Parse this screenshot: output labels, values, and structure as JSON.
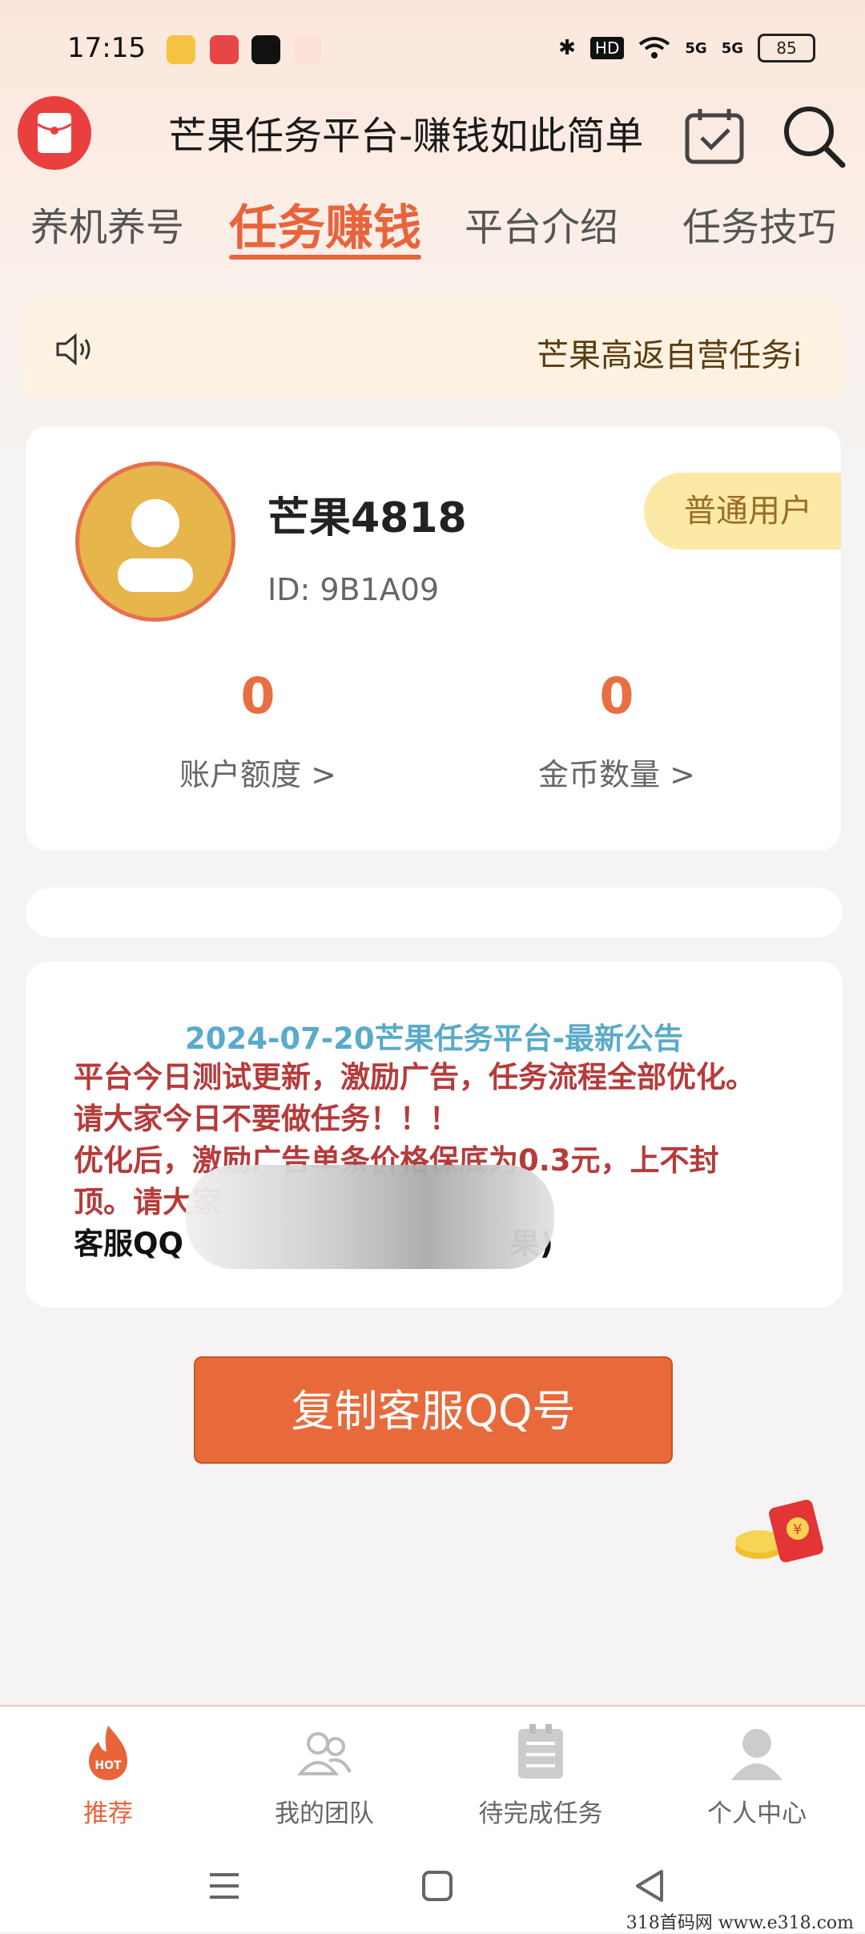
{
  "status_bar": {
    "time": "17:15",
    "battery": "85",
    "network_label": "5G",
    "hd_label": "HD"
  },
  "header": {
    "title": "芒果任务平台-赚钱如此简单",
    "icons": [
      "red-packet-icon",
      "calendar-check-icon",
      "search-icon"
    ]
  },
  "tabs": [
    {
      "label": "养机养号",
      "active": false
    },
    {
      "label": "任务赚钱",
      "active": true
    },
    {
      "label": "平台介绍",
      "active": false
    },
    {
      "label": "任务技巧",
      "active": false
    }
  ],
  "notice": {
    "text": "芒果高返自营任务i"
  },
  "profile": {
    "username": "芒果4818",
    "id": "ID: 9B1A09",
    "level": "普通用户",
    "stats": [
      {
        "value": "0",
        "label": "账户额度 >"
      },
      {
        "value": "0",
        "label": "金币数量 >"
      }
    ]
  },
  "announcement": {
    "title": "2024-07-20芒果任务平台-最新公告",
    "lines": [
      "平台今日测试更新，激励广告，任务流程全部优化。",
      "请大家今日不要做任务！！！",
      "优化后，激励广告单条价格保底为0.3元，上不封",
      "顶。请大家"
    ],
    "contact_prefix": "客服QQ",
    "contact_suffix": "果)"
  },
  "copy_button": {
    "label": "复制客服QQ号"
  },
  "bottom_nav": [
    {
      "label": "推荐",
      "icon": "hot-fire-icon",
      "active": true,
      "badge": "HOT"
    },
    {
      "label": "我的团队",
      "icon": "team-icon",
      "active": false
    },
    {
      "label": "待完成任务",
      "icon": "task-list-icon",
      "active": false
    },
    {
      "label": "个人中心",
      "icon": "user-icon",
      "active": false
    }
  ],
  "watermark": "318首码网  www.e318.com",
  "colors": {
    "accent": "#e8643c",
    "announce_title": "#5aaac9",
    "announce_body": "#b63b3b",
    "level_badge_bg": "#fbe9a5"
  }
}
